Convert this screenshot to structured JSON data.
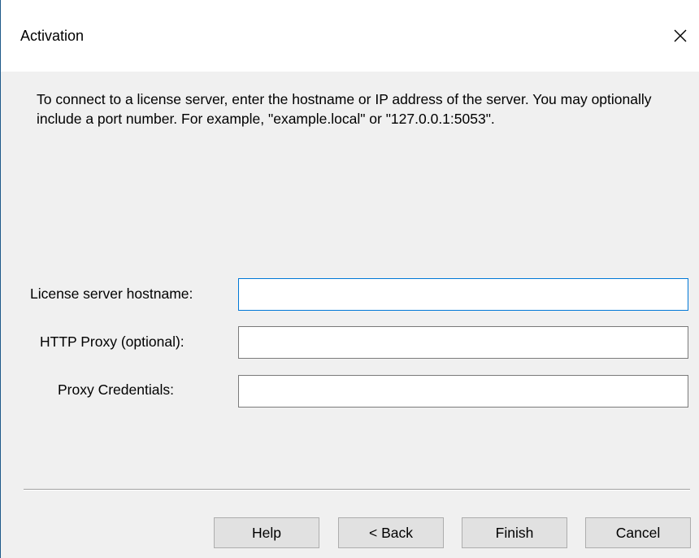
{
  "window": {
    "title": "Activation",
    "close_icon": "close-icon"
  },
  "instructions": "To connect to a license server, enter the hostname or IP address of the server. You may optionally include a port number. For example, \"example.local\" or \"127.0.0.1:5053\".",
  "fields": {
    "hostname": {
      "label": "License server hostname:",
      "value": ""
    },
    "proxy": {
      "label": "HTTP Proxy (optional):",
      "value": ""
    },
    "credentials": {
      "label": "Proxy Credentials:",
      "value": ""
    }
  },
  "buttons": {
    "help": "Help",
    "back": "< Back",
    "finish": "Finish",
    "cancel": "Cancel"
  },
  "colors": {
    "focus_border": "#0078d7",
    "window_border": "#1f5a8a",
    "dialog_background": "#f0f0f0"
  }
}
